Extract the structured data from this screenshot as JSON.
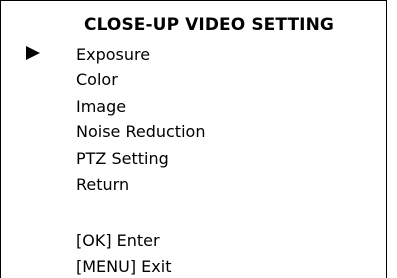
{
  "menu": {
    "title": "CLOSE-UP VIDEO SETTING",
    "selected_index": 0,
    "items": [
      {
        "label": "Exposure"
      },
      {
        "label": "Color"
      },
      {
        "label": "Image"
      },
      {
        "label": "Noise Reduction"
      },
      {
        "label": "PTZ Setting"
      },
      {
        "label": "Return"
      }
    ],
    "hints": [
      {
        "label": "[OK] Enter"
      },
      {
        "label": "[MENU] Exit"
      }
    ]
  },
  "icons": {
    "cursor": "play-triangle-cursor"
  }
}
